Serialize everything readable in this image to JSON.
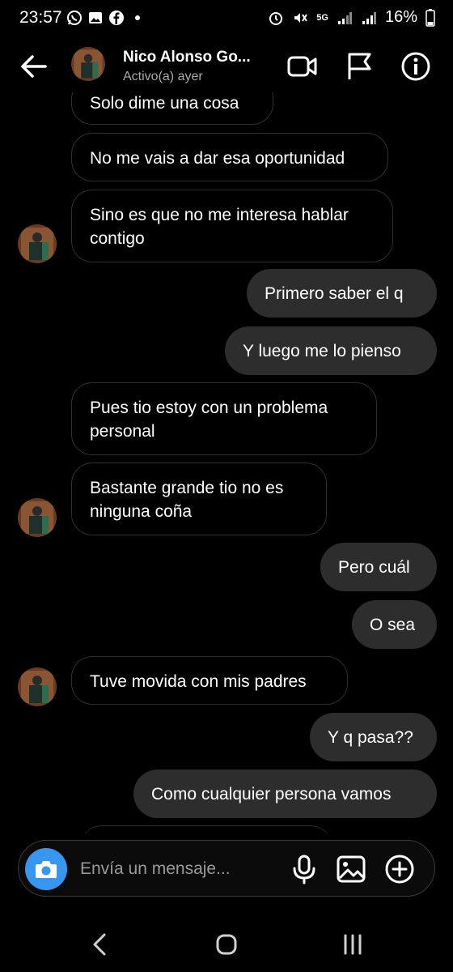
{
  "status_bar": {
    "time": "23:57",
    "network": "5G",
    "battery": "16%"
  },
  "header": {
    "name": "Nico Alonso Go...",
    "status": "Activo(a) ayer"
  },
  "messages": [
    {
      "direction": "in",
      "text": "Solo dime una cosa"
    },
    {
      "direction": "in",
      "text": "No me vais a dar esa oportunidad"
    },
    {
      "direction": "in",
      "text": "Sino es que no me interesa hablar\ncontigo"
    },
    {
      "direction": "out",
      "text": "Primero saber el q"
    },
    {
      "direction": "out",
      "text": "Y luego me lo pienso"
    },
    {
      "direction": "in",
      "text": "Pues tio estoy con un problema\npersonal"
    },
    {
      "direction": "in",
      "text": "Bastante grande tio no es\nninguna coña"
    },
    {
      "direction": "out",
      "text": "Pero cuál"
    },
    {
      "direction": "out",
      "text": "O sea"
    },
    {
      "direction": "in",
      "text": "Tuve movida con mis padres"
    },
    {
      "direction": "out",
      "text": "Y q pasa??"
    },
    {
      "direction": "out",
      "text": "Como cualquier persona vamos"
    }
  ],
  "composer": {
    "placeholder": "Envía un mensaje..."
  },
  "icons": {
    "accent_camera": "#3797f0",
    "outgoing_bubble": "#2d2d2d",
    "incoming_border": "#2f2f2f"
  }
}
